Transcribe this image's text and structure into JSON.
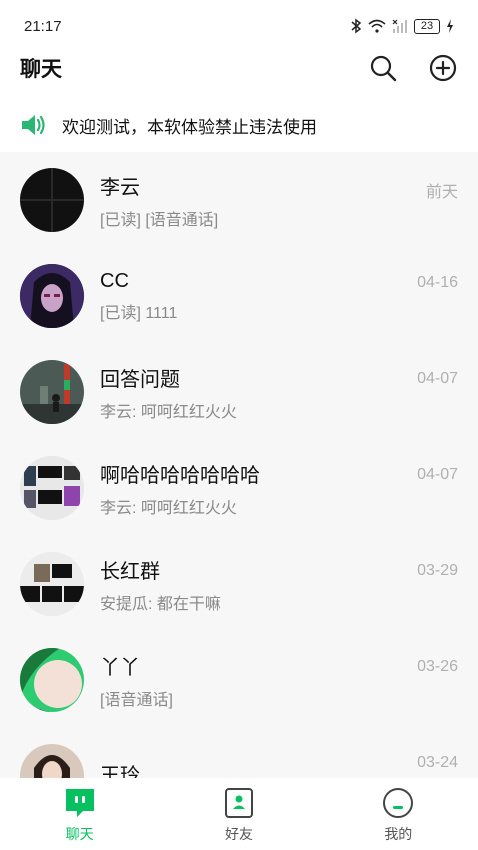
{
  "status_bar": {
    "time": "21:17",
    "battery": "23"
  },
  "header": {
    "title": "聊天"
  },
  "notice": {
    "text": "欢迎测试，本软体验禁止违法使用"
  },
  "colors": {
    "accent": "#07c160",
    "list_bg": "#f7f7f7"
  },
  "chats": [
    {
      "name": "李云",
      "preview": "[已读] [语音通话]",
      "time": "前天"
    },
    {
      "name": "CC",
      "preview": "[已读] 1111",
      "time": "04-16"
    },
    {
      "name": "回答问题",
      "preview": "李云: 呵呵红红火火",
      "time": "04-07"
    },
    {
      "name": "啊哈哈哈哈哈哈哈",
      "preview": "李云: 呵呵红红火火",
      "time": "04-07"
    },
    {
      "name": "长红群",
      "preview": "安提瓜: 都在干嘛",
      "time": "03-29"
    },
    {
      "name": "丫丫",
      "preview": "[语音通话]",
      "time": "03-26"
    },
    {
      "name": "王玲",
      "preview": "",
      "time": "03-24"
    }
  ],
  "tabs": [
    {
      "label": "聊天",
      "icon": "chat-icon",
      "active": true
    },
    {
      "label": "好友",
      "icon": "contacts-icon",
      "active": false
    },
    {
      "label": "我的",
      "icon": "profile-icon",
      "active": false
    }
  ]
}
